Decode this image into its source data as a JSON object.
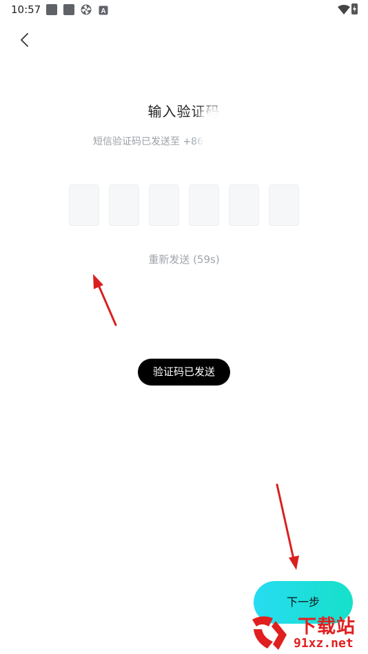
{
  "status_bar": {
    "time": "10:57",
    "notification_icons": [
      "gallery-icon",
      "gallery-icon",
      "aperture-icon",
      "keyboard-a-icon"
    ],
    "wifi_icon": "wifi-icon",
    "battery_icon": "battery-charging-icon"
  },
  "nav": {
    "back_icon": "chevron-left-icon"
  },
  "page": {
    "title": "输入验证码",
    "subtitle": "短信验证码已发送至 +86"
  },
  "code_input": {
    "length": 6,
    "boxes": [
      "",
      "",
      "",
      "",
      "",
      ""
    ]
  },
  "resend": {
    "label": "重新发送 (59s)"
  },
  "toast": {
    "message": "验证码已发送"
  },
  "next_button": {
    "label": "下一步"
  },
  "annotations": {
    "arrow_color": "#d9201f"
  },
  "watermark": {
    "text_large": "下载站",
    "text_small": "91xz.net",
    "color": "#e01f1f"
  },
  "colors": {
    "button_gradient_start": "#27dcf2",
    "button_gradient_end": "#16e0c9",
    "toast_bg": "#000000"
  }
}
